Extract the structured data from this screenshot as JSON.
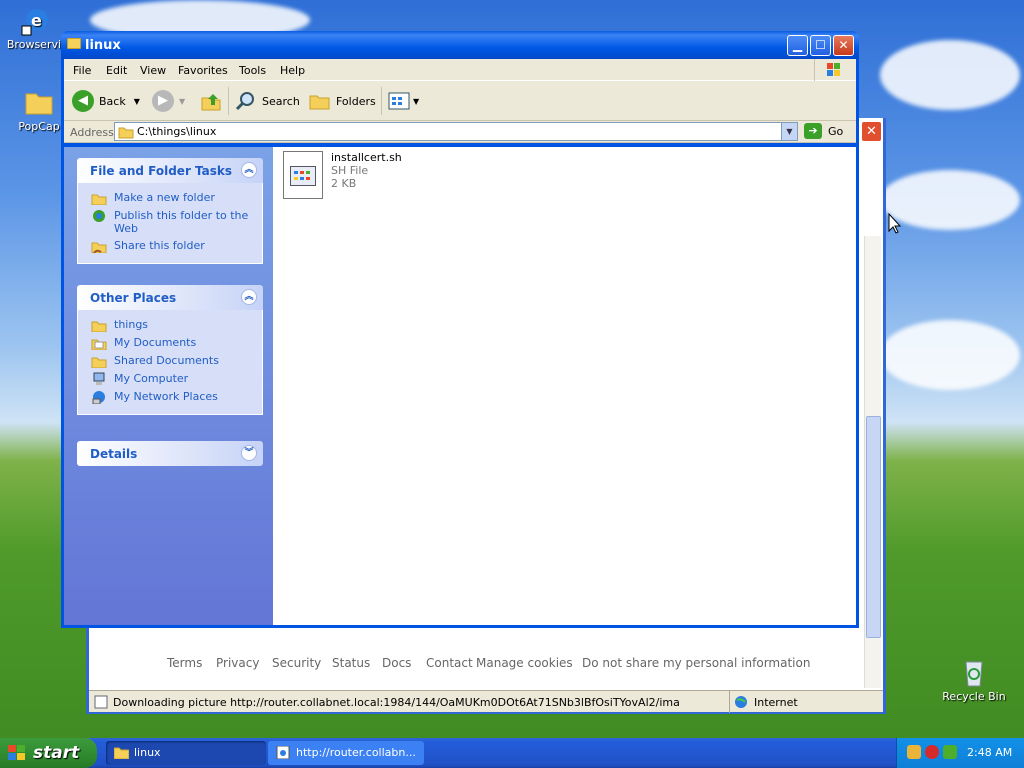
{
  "desktop": {
    "icons": [
      {
        "label": "Browservic",
        "icon": "ie-icon"
      },
      {
        "label": "PopCap",
        "icon": "folder-icon"
      },
      {
        "label": "Recycle Bin",
        "icon": "recycle-bin-icon"
      }
    ]
  },
  "browser": {
    "footer_links": [
      "Terms",
      "Privacy",
      "Security",
      "Status",
      "Docs",
      "Contact",
      "Manage cookies",
      "Do not share my personal information"
    ],
    "status_text": "Downloading picture http://router.collabnet.local:1984/144/OaMUKm0DOt6At71SNb3lBfOsiTYovAl2/ima",
    "zone": "Internet"
  },
  "explorer": {
    "title": "linux",
    "menu": [
      "File",
      "Edit",
      "View",
      "Favorites",
      "Tools",
      "Help"
    ],
    "toolbar": {
      "back": "Back",
      "search": "Search",
      "folders": "Folders"
    },
    "address": {
      "label": "Address",
      "value": "C:\\things\\linux",
      "go": "Go"
    },
    "panels": {
      "tasks": {
        "title": "File and Folder Tasks",
        "items": [
          "Make a new folder",
          "Publish this folder to the Web",
          "Share this folder"
        ]
      },
      "places": {
        "title": "Other Places",
        "items": [
          "things",
          "My Documents",
          "Shared Documents",
          "My Computer",
          "My Network Places"
        ]
      },
      "details": {
        "title": "Details"
      }
    },
    "files": [
      {
        "name": "installcert.sh",
        "type": "SH File",
        "size": "2 KB"
      }
    ]
  },
  "taskbar": {
    "start": "start",
    "items": [
      {
        "label": "linux"
      },
      {
        "label": "http://router.collabn..."
      }
    ],
    "clock": "2:48 AM"
  },
  "colors": {
    "accent": "#0054e3",
    "link": "#215dc6",
    "start_green": "#3c9a3c"
  }
}
